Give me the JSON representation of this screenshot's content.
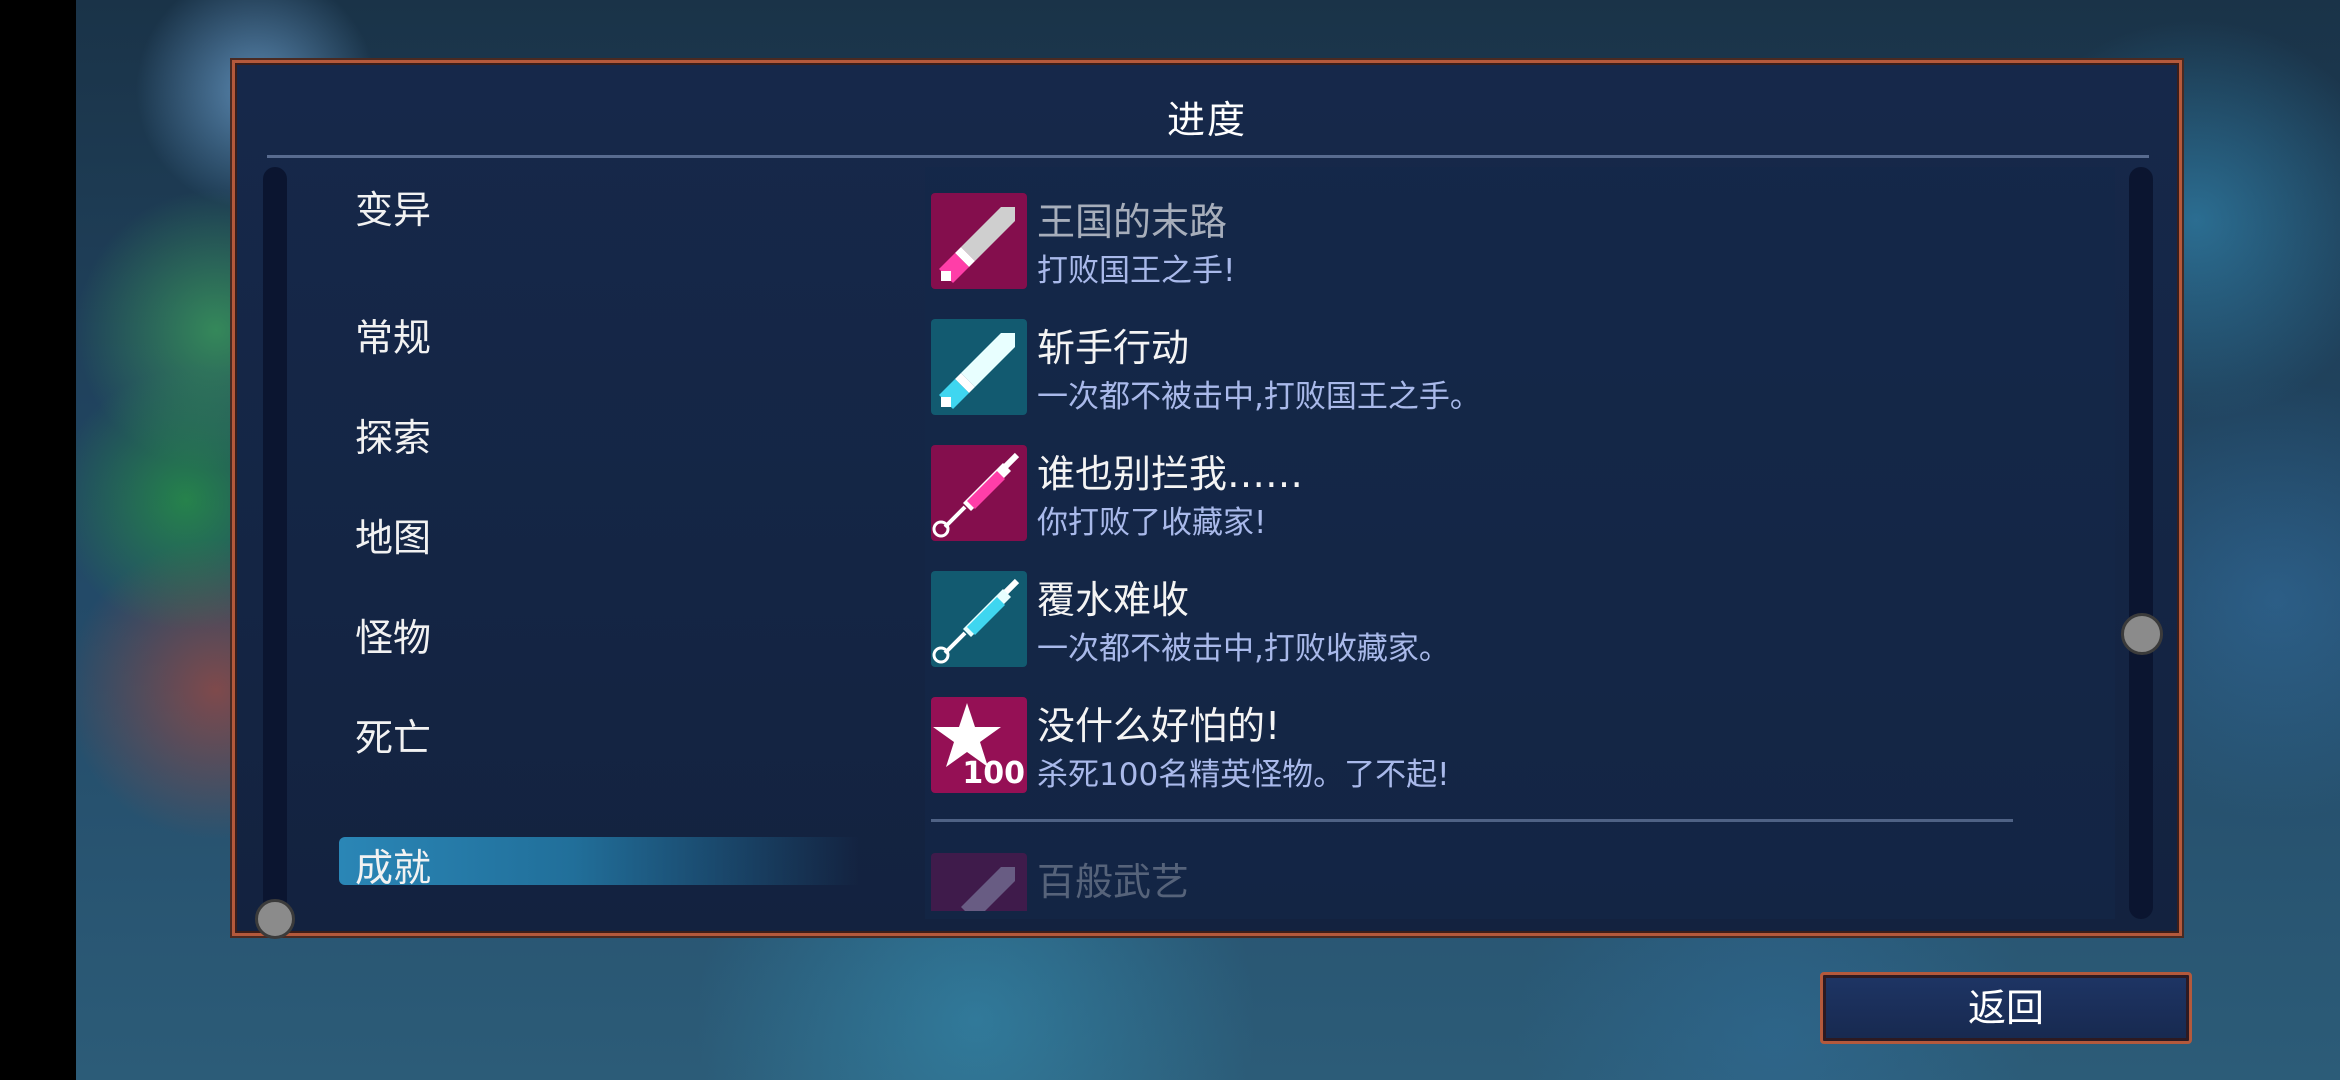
{
  "panel": {
    "title": "进度"
  },
  "sidebar": {
    "categories": [
      {
        "label": "变异"
      },
      {
        "label": "常规"
      },
      {
        "label": "探索"
      },
      {
        "label": "地图"
      },
      {
        "label": "怪物"
      },
      {
        "label": "死亡"
      },
      {
        "label": "成就",
        "selected": true
      }
    ]
  },
  "achievements": [
    {
      "title": "王国的末路",
      "desc": "打败国王之手!",
      "icon": "sword-icon",
      "color": "#e0157a",
      "unlocked": false
    },
    {
      "title": "斩手行动",
      "desc": "一次都不被击中,打败国王之手。",
      "icon": "sword-icon",
      "color": "#2bb8d8",
      "unlocked": true
    },
    {
      "title": "谁也别拦我……",
      "desc": "你打败了收藏家!",
      "icon": "syringe-icon",
      "color": "#e0157a",
      "unlocked": true
    },
    {
      "title": "覆水难收",
      "desc": "一次都不被击中,打败收藏家。",
      "icon": "syringe-icon",
      "color": "#2bb8d8",
      "unlocked": true
    },
    {
      "title": "没什么好怕的!",
      "desc": "杀死100名精英怪物。了不起!",
      "icon": "star-icon",
      "badge": "100",
      "color": "#e0157a",
      "unlocked": true
    },
    {
      "title": "百般武艺",
      "desc": "",
      "icon": "sword-icon",
      "color": "#b01880",
      "unlocked": false
    }
  ],
  "footer": {
    "back_label": "返回"
  },
  "colors": {
    "accent_border": "#b4593c",
    "panel_bg": "#16284a",
    "selected_bar": "#2a86b6",
    "desc_text": "#a9b9ea"
  }
}
